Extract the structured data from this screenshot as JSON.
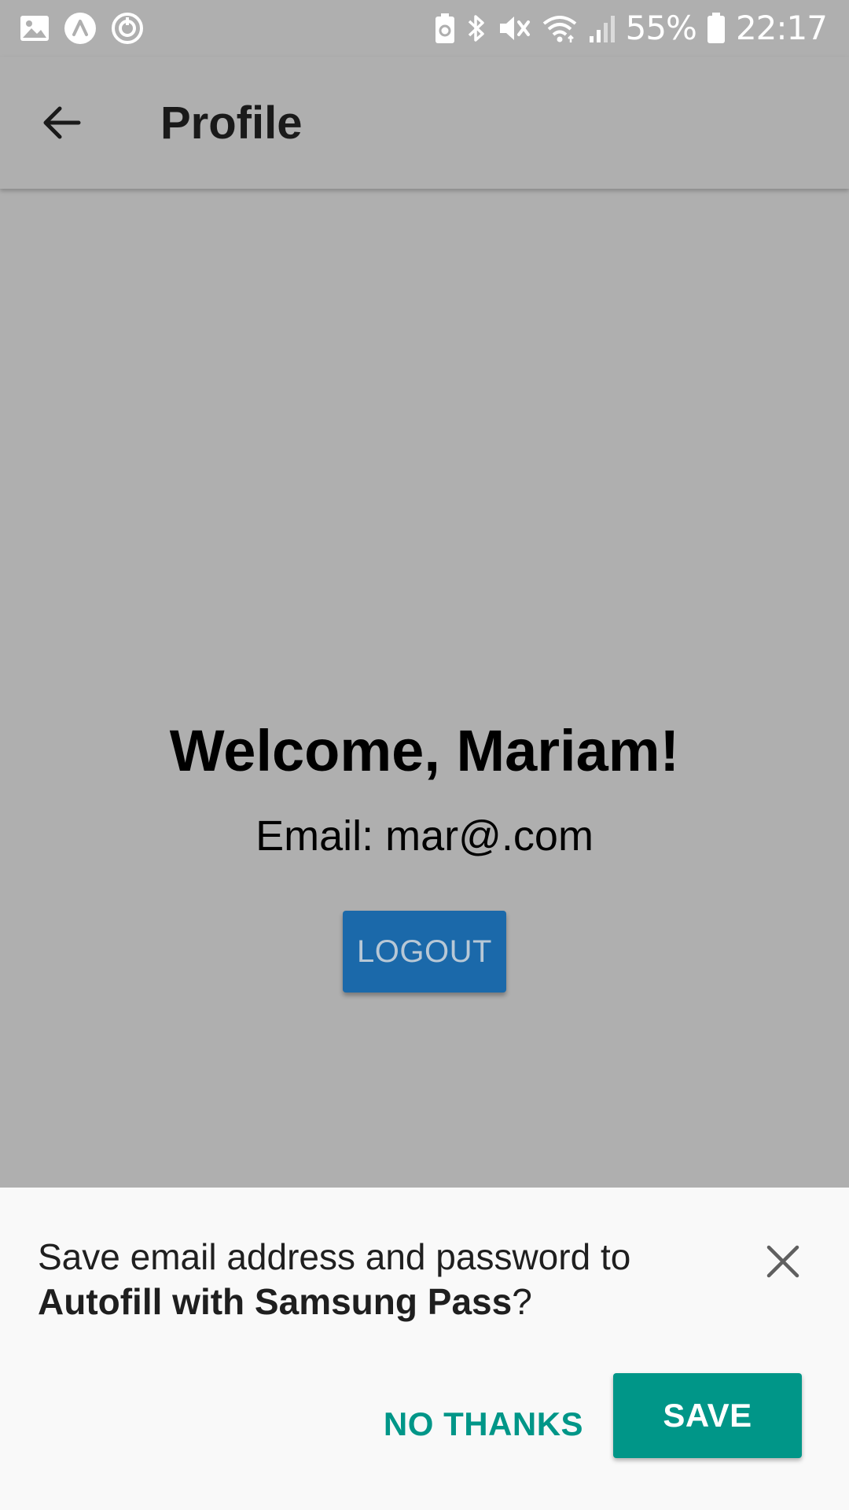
{
  "status_bar": {
    "left_icons": [
      "gallery-icon",
      "app-a-icon",
      "sync-icon"
    ],
    "right_icons": [
      "battery-saver-icon",
      "bluetooth-icon",
      "mute-icon",
      "wifi-icon",
      "signal-icon",
      "battery-icon"
    ],
    "battery_percent": "55%",
    "time": "22:17"
  },
  "app_bar": {
    "title": "Profile",
    "back_icon": "arrow-back-icon"
  },
  "profile": {
    "welcome": "Welcome, Mariam!",
    "email": "Email: mar@.com",
    "logout_label": "LOGOUT",
    "logout_color": "#1b69aa"
  },
  "autofill_sheet": {
    "message_prefix": "Save email address and password to",
    "message_bold": "Autofill with Samsung Pass",
    "message_suffix": "?",
    "close_icon": "close-icon",
    "no_thanks_label": "NO THANKS",
    "save_label": "SAVE",
    "accent_color": "#009688"
  },
  "colors": {
    "scrim_background": "#afafaf",
    "sheet_background": "#f9f9f9"
  }
}
